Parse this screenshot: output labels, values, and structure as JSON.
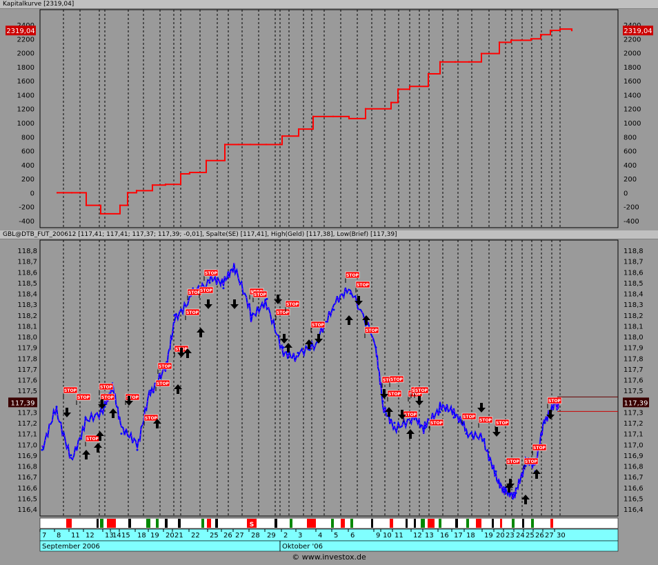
{
  "top_pane": {
    "title": "Kapitalkurve [2319,04]",
    "last_value_label": "2319,04",
    "y_ticks": [
      "2400",
      "2200",
      "2000",
      "1800",
      "1600",
      "1400",
      "1200",
      "1000",
      "800",
      "600",
      "400",
      "200",
      "0",
      "-200",
      "-400"
    ]
  },
  "bottom_pane": {
    "title": "GBL@DTB_FUT_200612 [117,41; 117,41; 117,37; 117,39; -0,01],  Spalte(SE) [117,41],  High(Geld) [117,38],  Low(Brief) [117,39]",
    "last_value_label": "117,39",
    "y_ticks": [
      "118,8",
      "118,7",
      "118,6",
      "118,5",
      "118,4",
      "118,3",
      "118,2",
      "118,1",
      "118,0",
      "117,9",
      "117,8",
      "117,7",
      "117,6",
      "117,5",
      "117,4",
      "117,3",
      "117,2",
      "117,1",
      "117,0",
      "116,9",
      "116,8",
      "116,7",
      "116,6",
      "116,5",
      "116,4"
    ],
    "stop_label": "STOP",
    "trade_strip_letter": "S"
  },
  "x_axis": {
    "day_labels": [
      "7",
      "8",
      "11",
      "12",
      "13",
      "14",
      "15",
      "18",
      "19",
      "20",
      "21",
      "22",
      "25",
      "26",
      "27",
      "28",
      "29",
      "2",
      "3",
      "4",
      "5",
      "6",
      "9",
      "10",
      "11",
      "12",
      "13",
      "16",
      "17",
      "18",
      "19",
      "20",
      "23",
      "24",
      "25",
      "26",
      "27",
      "30"
    ],
    "month_labels": [
      "September 2006",
      "Oktober '06"
    ]
  },
  "footer_text": "© www.investox.de",
  "colors": {
    "background": "#9a9a9a",
    "equity_line": "#ff0000",
    "price_line": "#0000ff",
    "axis_strip": "#80ffff",
    "stop_flag": "#ff0000",
    "last_value_box": "#cc0000"
  },
  "chart_data": [
    {
      "type": "line",
      "title": "Kapitalkurve",
      "ylim": [
        -400,
        2450
      ],
      "x": [
        "7",
        "8",
        "11",
        "12",
        "13",
        "14",
        "15",
        "18",
        "19",
        "20",
        "21",
        "22",
        "25",
        "26",
        "27",
        "28",
        "29",
        "2",
        "3",
        "4",
        "5",
        "6",
        "9",
        "10",
        "11",
        "12",
        "13",
        "16",
        "17",
        "18",
        "19",
        "20",
        "23",
        "24",
        "25",
        "26",
        "27",
        "30"
      ],
      "series": [
        {
          "name": "Kapitalkurve",
          "values": [
            0,
            0,
            -180,
            -300,
            -180,
            0,
            30,
            110,
            120,
            270,
            290,
            460,
            690,
            690,
            690,
            690,
            810,
            910,
            1090,
            1090,
            1060,
            1200,
            1290,
            1480,
            1520,
            1700,
            1870,
            1870,
            1870,
            1990,
            2150,
            2180,
            2180,
            2200,
            2260,
            2320,
            2340,
            2319.04
          ]
        }
      ]
    },
    {
      "type": "line",
      "title": "GBL@DTB_FUT_200612",
      "ylim": [
        116.35,
        118.85
      ],
      "x": [
        "7",
        "8",
        "11",
        "12",
        "13",
        "14",
        "15",
        "18",
        "19",
        "20",
        "21",
        "22",
        "25",
        "26",
        "27",
        "28",
        "29",
        "2",
        "3",
        "4",
        "5",
        "6",
        "9",
        "10",
        "11",
        "12",
        "13",
        "16",
        "17",
        "18",
        "19",
        "20",
        "23",
        "24",
        "25",
        "26",
        "27",
        "30"
      ],
      "series": [
        {
          "name": "GBL@DTB_FUT_200612",
          "values": [
            116.95,
            117.35,
            116.9,
            117.25,
            117.35,
            117.5,
            117.1,
            116.95,
            117.5,
            117.75,
            118.2,
            118.4,
            118.5,
            118.45,
            118.6,
            118.2,
            118.35,
            117.9,
            117.85,
            117.95,
            118.25,
            118.4,
            117.9,
            117.4,
            117.2,
            117.3,
            117.15,
            117.3,
            117.25,
            117.1,
            117.05,
            116.75,
            116.6,
            116.55,
            116.8,
            116.75,
            117.2,
            117.39
          ]
        }
      ]
    }
  ]
}
